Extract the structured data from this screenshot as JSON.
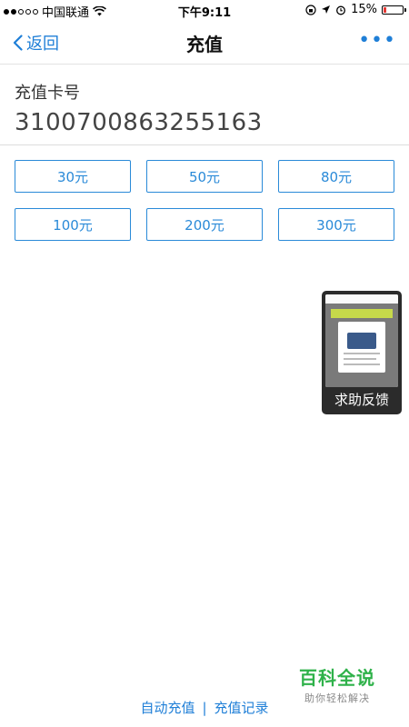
{
  "status_bar": {
    "carrier": "中国联通",
    "time": "下午9:11",
    "battery_percent": "15%",
    "battery_level": 0.15,
    "battery_color": "#e53935",
    "icons": [
      "signal-dots-icon",
      "wifi-icon",
      "lock-rotation-icon",
      "location-arrow-icon",
      "alarm-icon",
      "battery-icon"
    ]
  },
  "nav": {
    "back_label": "返回",
    "title": "充值",
    "more_label": "•••"
  },
  "card": {
    "label": "充值卡号",
    "number": "3100700863255163"
  },
  "amounts": [
    {
      "label": "30元"
    },
    {
      "label": "50元"
    },
    {
      "label": "80元"
    },
    {
      "label": "100元"
    },
    {
      "label": "200元"
    },
    {
      "label": "300元"
    }
  ],
  "help": {
    "label": "求助反馈"
  },
  "footer": {
    "auto_recharge": "自动充值",
    "separator": "|",
    "recharge_records": "充值记录"
  },
  "watermark": {
    "title": "百科全说",
    "subtitle": "助你轻松解决"
  },
  "colors": {
    "accent": "#1f7fd7",
    "amount_border": "#2a8ad8",
    "watermark_green": "#2fb24a"
  }
}
